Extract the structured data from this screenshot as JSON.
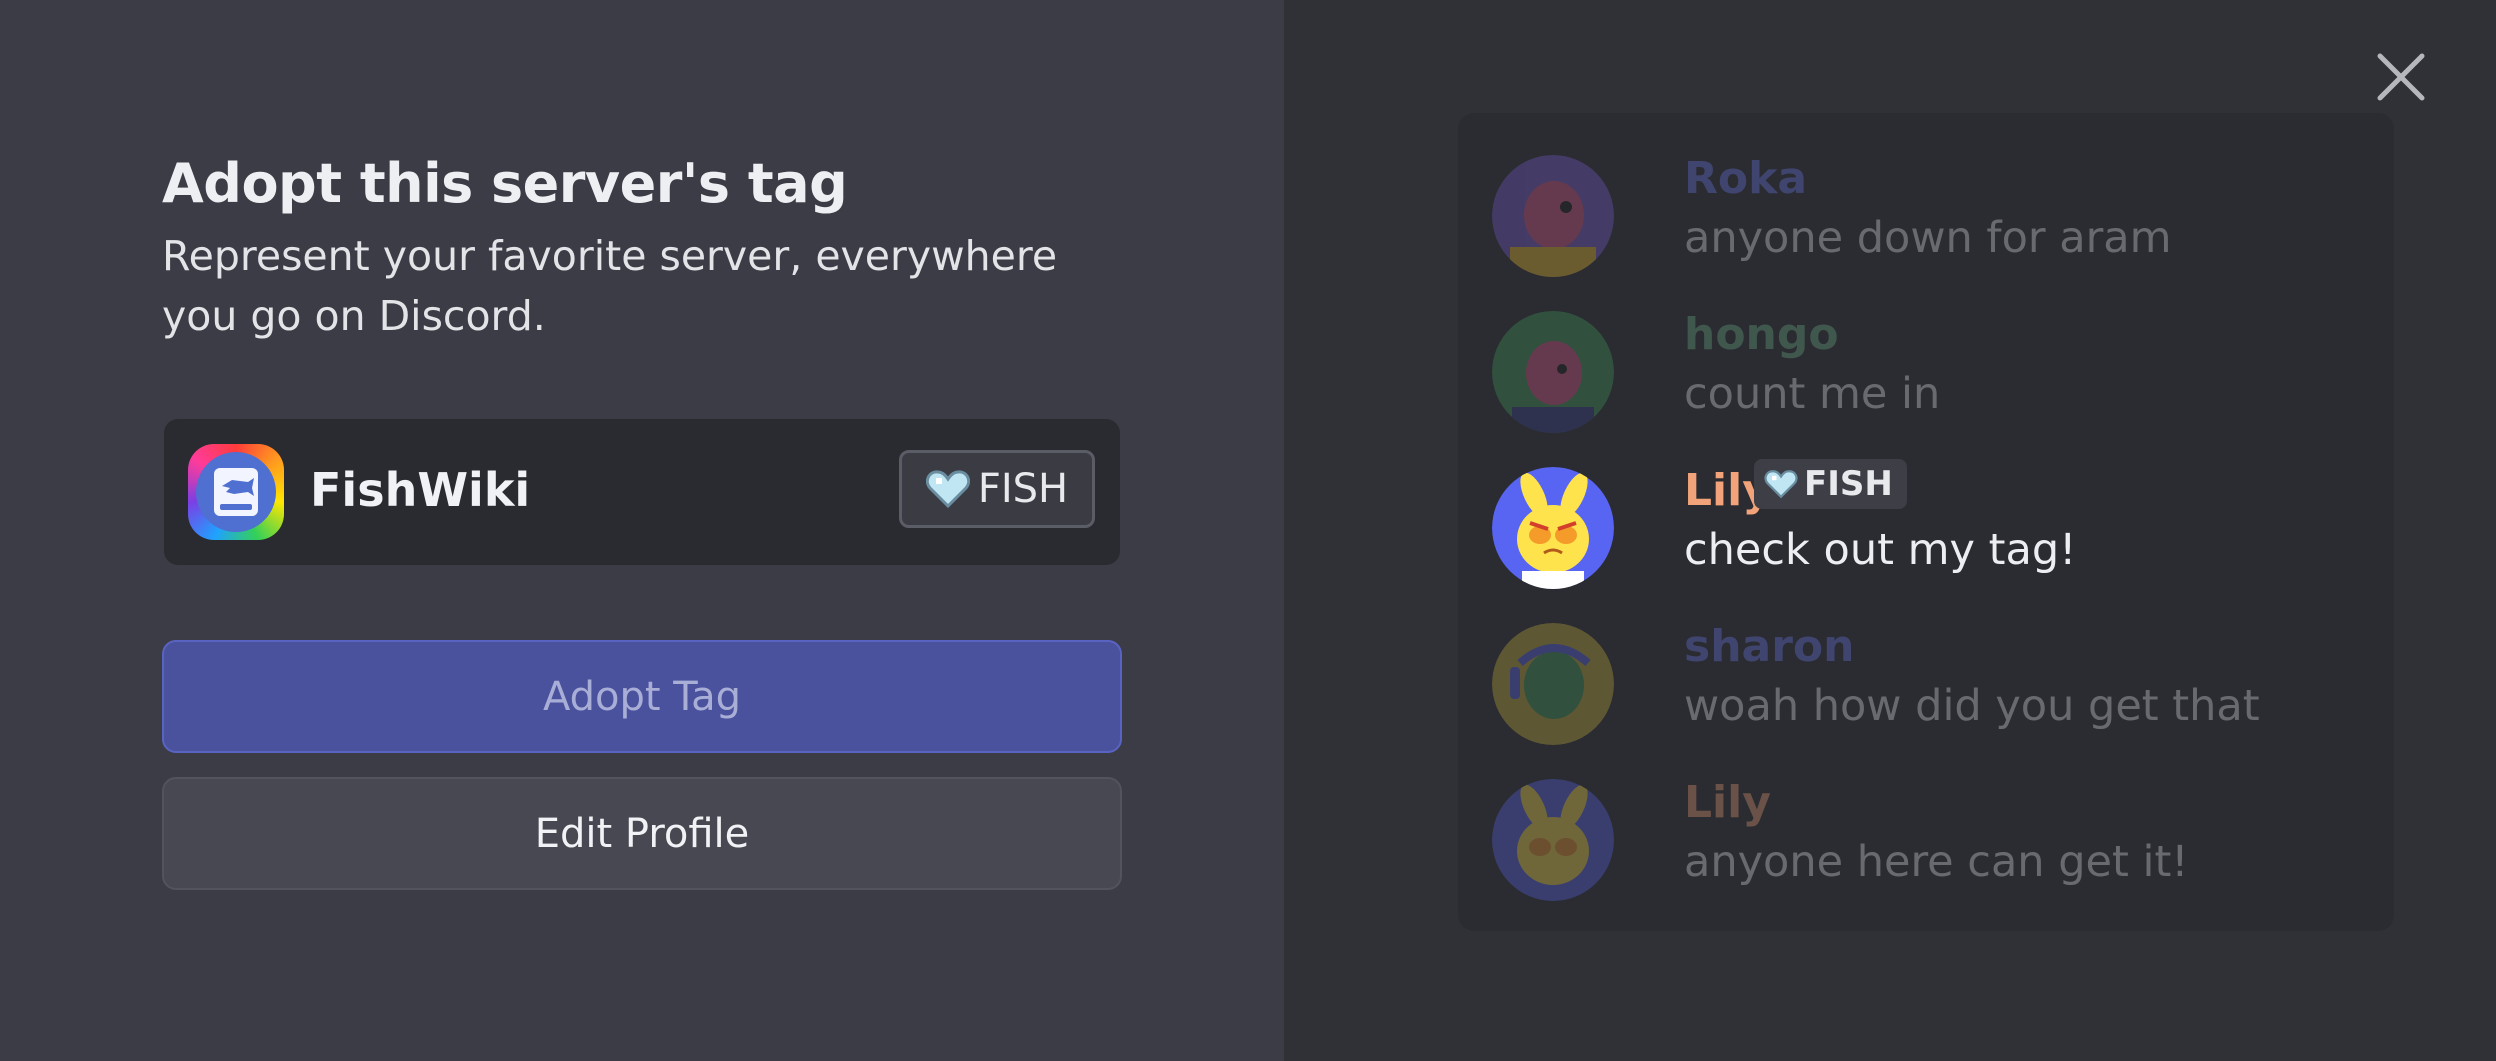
{
  "dialog": {
    "title": "Adopt this server's tag",
    "subtitle": "Represent your favorite server, everywhere you go on Discord."
  },
  "server": {
    "name": "FishWiki",
    "icon": "fishwiki-book-icon",
    "tag": {
      "icon": "heart-icon",
      "label": "FISH"
    }
  },
  "buttons": {
    "adopt_label": "Adopt Tag",
    "edit_label": "Edit Profile"
  },
  "close_icon": "close-icon",
  "chat": {
    "messages": [
      {
        "author": "Roka",
        "text": "anyone down for aram",
        "name_color": "#6e7bf2",
        "avatar_color": "#7b5bd6",
        "highlight": false
      },
      {
        "author": "hongo",
        "text": "count me in",
        "name_color": "#6bb38a",
        "avatar_color": "#3f9d5a",
        "highlight": false
      },
      {
        "author": "Lily",
        "text": "check out my tag!",
        "name_color": "#f2a37a",
        "avatar_color": "#5865f2",
        "highlight": true,
        "tag": {
          "icon": "heart-icon",
          "label": "FISH"
        }
      },
      {
        "author": "sharon",
        "text": "woah how did you get that",
        "name_color": "#6e7bf2",
        "avatar_color": "#c9b23a",
        "highlight": false
      },
      {
        "author": "Lily",
        "text": "anyone here can get it!",
        "name_color": "#f2a37a",
        "avatar_color": "#5865f2",
        "highlight": false
      }
    ]
  },
  "colors": {
    "brand": "#5865f2",
    "tag_heart": "#bfe6f2"
  }
}
